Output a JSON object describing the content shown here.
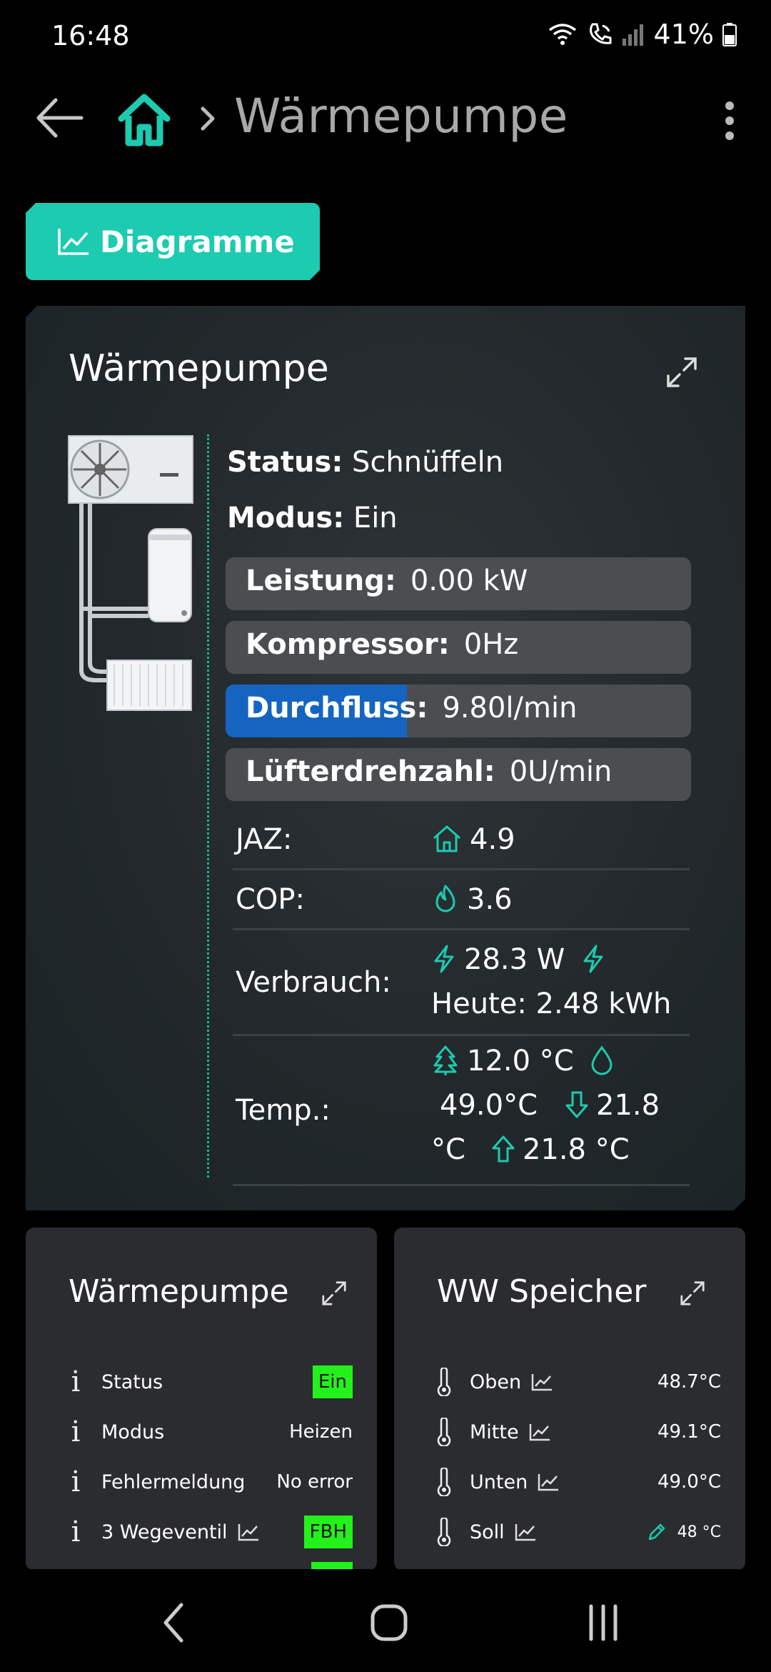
{
  "status_bar": {
    "time": "16:48",
    "battery": "41%",
    "icons": [
      "wifi-calling-icon",
      "call-icon",
      "signal-icon",
      "battery-icon"
    ]
  },
  "header": {
    "title": "Wärmepumpe",
    "separator": ">",
    "icons": [
      "back-arrow-icon",
      "home-icon",
      "more-vert-icon"
    ]
  },
  "diagram_button": {
    "label": "Diagramme",
    "icon": "chart-line-icon"
  },
  "colors": {
    "accent": "#1ccbb0",
    "background": "#000000",
    "card": "#2a2c2f",
    "flow_bar": "#1565c0",
    "badge_green": "#22f21a"
  },
  "main_card": {
    "title": "Wärmepumpe",
    "status_label": "Status:",
    "status_value": "Schnüffeln",
    "mode_label": "Modus:",
    "mode_value": "Ein",
    "bars": [
      {
        "label": "Leistung:",
        "value": "0.00 kW",
        "fill": 0
      },
      {
        "label": "Kompressor:",
        "value": "0Hz",
        "fill": 0
      },
      {
        "label": "Durchfluss:",
        "value": "9.80l/min",
        "fill": 0.39
      },
      {
        "label": "Lüfterdrehzahl:",
        "value": "0U/min",
        "fill": 0
      }
    ],
    "stats": {
      "jaz_label": "JAZ:",
      "jaz_value": "4.9",
      "cop_label": "COP:",
      "cop_value": "3.6",
      "consumption_label": "Verbrauch:",
      "consumption_now": "28.3 W",
      "consumption_today": "Heute: 2.48 kWh",
      "temp_label": "Temp.:",
      "temp_outdoor": "12.0 °C",
      "temp_water": "49.0°C",
      "temp_return_a": "21.8",
      "temp_return_b": "°C",
      "temp_flow": "21.8 °C"
    }
  },
  "heatpump_card": {
    "title": "Wärmepumpe",
    "rows": [
      {
        "label": "Status",
        "value": "Ein",
        "badge": true
      },
      {
        "label": "Modus",
        "value": "Heizen"
      },
      {
        "label": "Fehlermeldung",
        "value": "No error"
      },
      {
        "label": "3 Wegeventil",
        "value": "FBH",
        "badge": true
      }
    ]
  },
  "storage_card": {
    "title": "WW Speicher",
    "rows": [
      {
        "label": "Oben",
        "value": "48.7°C"
      },
      {
        "label": "Mitte",
        "value": "49.1°C"
      },
      {
        "label": "Unten",
        "value": "49.0°C"
      },
      {
        "label": "Soll",
        "value": "48 °C"
      }
    ]
  },
  "nav": {
    "icons": [
      "nav-back-icon",
      "nav-home-icon",
      "nav-recents-icon"
    ]
  }
}
